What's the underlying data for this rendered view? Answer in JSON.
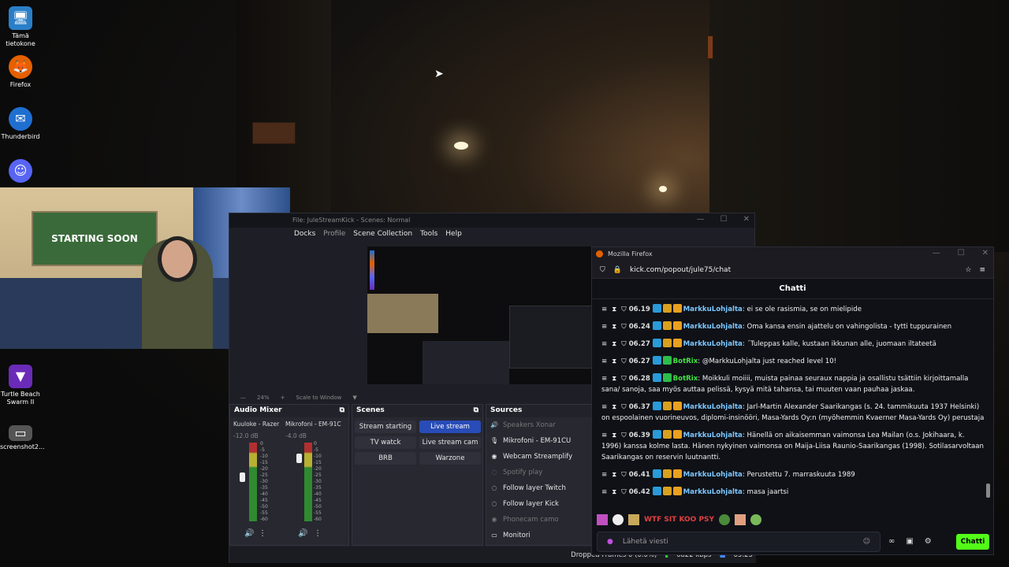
{
  "desktop": {
    "icons": [
      {
        "label": "Tämä tietokone",
        "glyph": "🖥"
      },
      {
        "label": "Firefox",
        "glyph": "🦊"
      },
      {
        "label": "Thunderbird",
        "glyph": "✉"
      },
      {
        "label": "Discord",
        "glyph": "☺"
      },
      {
        "label": "Turtle Beach Swarm II",
        "glyph": "▼"
      },
      {
        "label": "screenshot2...",
        "glyph": "▭"
      }
    ]
  },
  "webcam": {
    "banner": "STARTING SOON"
  },
  "obs": {
    "title": "File: JuleStreamKick - Scenes: Normal",
    "menu": [
      {
        "label": "Docks",
        "dim": false
      },
      {
        "label": "Profile",
        "dim": true
      },
      {
        "label": "Scene Collection",
        "dim": false
      },
      {
        "label": "Tools",
        "dim": false
      },
      {
        "label": "Help",
        "dim": false
      }
    ],
    "zoom": "24%",
    "scale_mode": "Scale to Window",
    "audio_mixer": {
      "title": "Audio Mixer",
      "channels": [
        {
          "name": "Kuuloke - Razer",
          "db": "-12.0 dB",
          "level": 0.6
        },
        {
          "name": "Mikrofoni - EM-91C",
          "db": "-4.0 dB",
          "level": 0.85
        }
      ],
      "scale": [
        "0",
        "-5",
        "-10",
        "-15",
        "-20",
        "-25",
        "-30",
        "-35",
        "-40",
        "-45",
        "-50",
        "-55",
        "-60"
      ]
    },
    "scenes": {
      "title": "Scenes",
      "items": [
        {
          "label": "Stream starting",
          "active": false
        },
        {
          "label": "Live stream",
          "active": true
        },
        {
          "label": "TV watck",
          "active": false
        },
        {
          "label": "Live stream cam",
          "active": false
        },
        {
          "label": "BRB",
          "active": false
        },
        {
          "label": "Warzone",
          "active": false
        }
      ]
    },
    "sources": {
      "title": "Sources",
      "items": [
        {
          "label": "Speakers Xonar",
          "dim": true,
          "icon": "🔊"
        },
        {
          "label": "Mikrofoni - EM-91CU",
          "dim": false,
          "icon": "🎙"
        },
        {
          "label": "Webcam Streamplify",
          "dim": false,
          "icon": "◉"
        },
        {
          "label": "Spotify play",
          "dim": true,
          "icon": "◌"
        },
        {
          "label": "Follow layer Twitch",
          "dim": false,
          "icon": "◌"
        },
        {
          "label": "Follow layer Kick",
          "dim": false,
          "icon": "◌"
        },
        {
          "label": "Phonecam camo",
          "dim": true,
          "icon": "◉"
        },
        {
          "label": "Monitori",
          "dim": false,
          "icon": "▭"
        }
      ]
    },
    "status": {
      "dropped": "Dropped Frames 0 (0.0%)",
      "kbps": "6822 kbps",
      "time": "05:25"
    }
  },
  "firefox": {
    "title": "Mozilla Firefox",
    "url": "kick.com/popout/jule75/chat",
    "chat_title": "Chatti",
    "messages": [
      {
        "time": "06.19",
        "user": "MarkkuLohjalta",
        "bot": false,
        "text": ": ei se ole rasismia, se on mielipide"
      },
      {
        "time": "06.24",
        "user": "MarkkuLohjalta",
        "bot": false,
        "text": ": Oma kansa ensin ajattelu on vahingolista - tytti tuppurainen"
      },
      {
        "time": "06.27",
        "user": "MarkkuLohjalta",
        "bot": false,
        "text": ": ´Tuleppas kalle, kustaan ikkunan alle, juomaan iltateetä"
      },
      {
        "time": "06.27",
        "user": "BotRix",
        "bot": true,
        "text": ": @MarkkuLohjalta just reached level 10!"
      },
      {
        "time": "06.28",
        "user": "BotRix",
        "bot": true,
        "text": ": Moikkuli moiiii, muista painaa seuraux nappia ja osallistu tsättiin kirjoittamalla sana/ sanoja, saa myös auttaa pelissä, kysyä mitä tahansa, tai muuten vaan pauhaa jaskaa."
      },
      {
        "time": "06.37",
        "user": "MarkkuLohjalta",
        "bot": false,
        "text": ": Jarl-Martin Alexander Saarikangas (s. 24. tammikuuta 1937 Helsinki) on espoolainen vuorineuvos, diplomi-insinööri, Masa-Yards Oy:n (myöhemmin Kvaerner Masa-Yards Oy) perustaja"
      },
      {
        "time": "06.39",
        "user": "MarkkuLohjalta",
        "bot": false,
        "text": ": Hänellä on aikaisemman vaimonsa Lea Mailan (o.s. Jokihaara, k. 1996) kanssa kolme lasta. Hänen nykyinen vaimonsa on Maija-Liisa Raunio-Saarikangas (1998). Sotilasarvoltaan Saarikangas on reservin luutnantti."
      },
      {
        "time": "06.41",
        "user": "MarkkuLohjalta",
        "bot": false,
        "text": ": Perustettu 7. marraskuuta 1989"
      },
      {
        "time": "06.42",
        "user": "MarkkuLohjalta",
        "bot": false,
        "text": ": masa jaartsi"
      }
    ],
    "emote_text": "WTF SIT KOO PSY",
    "input_placeholder": "Lähetä viesti",
    "send_label": "Chatti"
  }
}
